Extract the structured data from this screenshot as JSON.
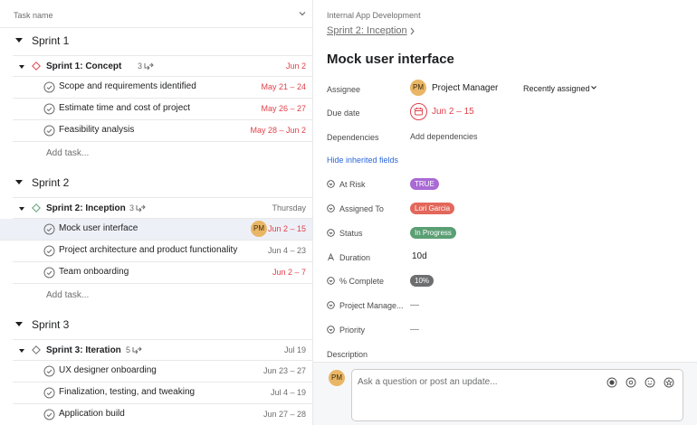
{
  "list": {
    "column_header": "Task name",
    "add_task_label": "Add task..."
  },
  "sections": [
    {
      "name": "Sprint 1",
      "milestone": {
        "title": "Sprint 1: Concept",
        "subtask_count": "3",
        "date": "Jun 2",
        "date_red": true
      },
      "tasks": [
        {
          "title": "Scope and requirements identified",
          "date": "May 21 – 24",
          "date_red": true
        },
        {
          "title": "Estimate time and cost of project",
          "date": "May 26 – 27",
          "date_red": true
        },
        {
          "title": "Feasibility analysis",
          "date": "May 28 – Jun 2",
          "date_red": true
        }
      ]
    },
    {
      "name": "Sprint 2",
      "milestone": {
        "title": "Sprint 2: Inception",
        "subtask_count": "3",
        "date": "Thursday",
        "date_red": false
      },
      "tasks": [
        {
          "title": "Mock user interface",
          "date": "Jun 2 – 15",
          "date_red": true,
          "assignee_initials": "PM",
          "selected": true
        },
        {
          "title": "Project architecture and product functionality",
          "date": "Jun 4 – 23",
          "date_red": false
        },
        {
          "title": "Team onboarding",
          "date": "Jun 2 – 7",
          "date_red": true
        }
      ]
    },
    {
      "name": "Sprint 3",
      "milestone": {
        "title": "Sprint 3: Iteration",
        "subtask_count": "5",
        "date": "Jul 19",
        "date_red": false
      },
      "tasks": [
        {
          "title": "UX designer onboarding",
          "date": "Jun 23 – 27",
          "date_red": false
        },
        {
          "title": "Finalization, testing, and tweaking",
          "date": "Jul 4 – 19",
          "date_red": false
        },
        {
          "title": "Application build",
          "date": "Jun 27 – 28",
          "date_red": false
        }
      ]
    }
  ],
  "detail": {
    "project": "Internal App Development",
    "parent": "Sprint 2: Inception",
    "title": "Mock user interface",
    "assignee_label": "Assignee",
    "assignee_initials": "PM",
    "assignee_name": "Project Manager",
    "recently_assigned": "Recently assigned",
    "due_label": "Due date",
    "due_value": "Jun 2 – 15",
    "dependencies_label": "Dependencies",
    "add_dependencies": "Add dependencies",
    "hide_inherited": "Hide inherited fields",
    "fields": {
      "at_risk": {
        "label": "At Risk",
        "value": "TRUE",
        "color": "#a96ad4"
      },
      "assigned_to": {
        "label": "Assigned To",
        "value": "Lori Garcia",
        "color": "#e3675b"
      },
      "status": {
        "label": "Status",
        "value": "In Progress",
        "color": "#5a9f73"
      },
      "duration": {
        "label": "Duration",
        "value": "10d"
      },
      "complete": {
        "label": "% Complete",
        "value": "10%",
        "color": "#6d6e6f"
      },
      "project_manager": {
        "label": "Project Manage...",
        "value": "—"
      },
      "priority": {
        "label": "Priority",
        "value": "—"
      }
    },
    "description_label": "Description",
    "comment_initials": "PM",
    "comment_placeholder": "Ask a question or post an update..."
  },
  "colors": {
    "overdue": "#e0424b",
    "link": "#2b66d9",
    "avatar": "#e9b665",
    "selected_row": "#eef0f7"
  }
}
